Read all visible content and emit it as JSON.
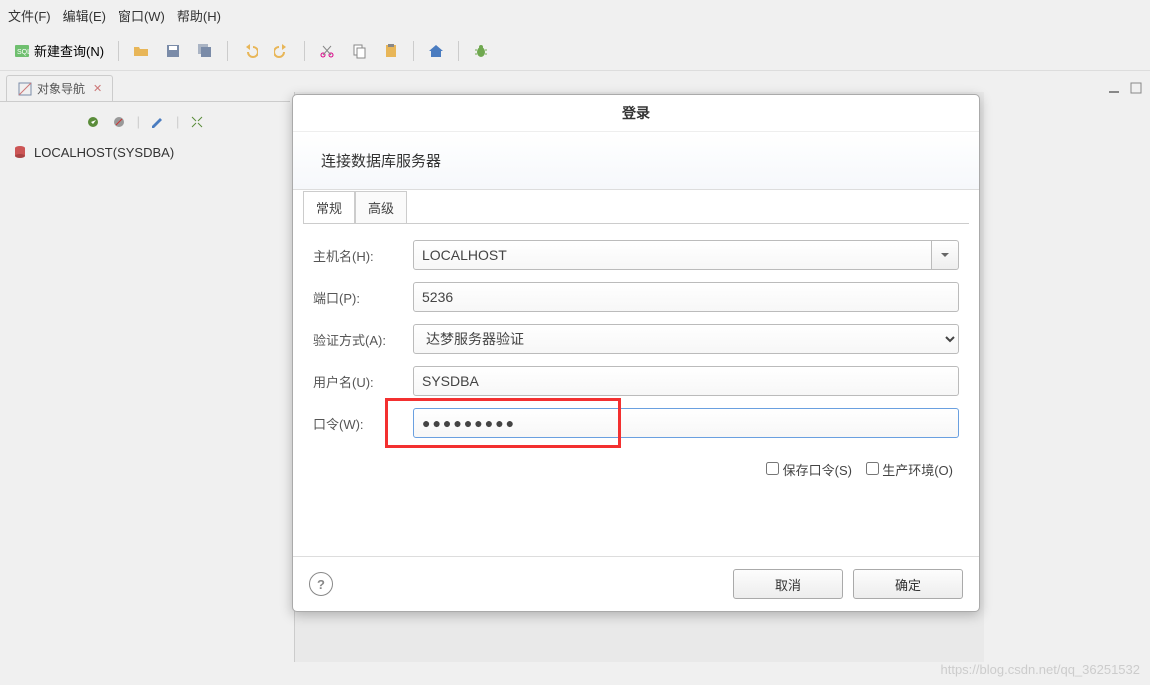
{
  "menu": {
    "file": "文件(F)",
    "edit": "编辑(E)",
    "window": "窗口(W)",
    "help": "帮助(H)"
  },
  "toolbar": {
    "new_query": "新建查询(N)"
  },
  "sidebar": {
    "tab_label": "对象导航",
    "tree_item": "LOCALHOST(SYSDBA)"
  },
  "dialog": {
    "title": "登录",
    "subtitle": "连接数据库服务器",
    "tabs": {
      "general": "常规",
      "advanced": "高级"
    },
    "labels": {
      "hostname": "主机名(H):",
      "port": "端口(P):",
      "auth": "验证方式(A):",
      "user": "用户名(U):",
      "password": "口令(W):"
    },
    "values": {
      "hostname": "LOCALHOST",
      "port": "5236",
      "auth": "达梦服务器验证",
      "user": "SYSDBA",
      "password": "●●●●●●●●●"
    },
    "checks": {
      "save_pw": "保存口令(S)",
      "prod": "生产环境(O)"
    },
    "buttons": {
      "cancel": "取消",
      "ok": "确定"
    }
  },
  "watermark": "https://blog.csdn.net/qq_36251532"
}
